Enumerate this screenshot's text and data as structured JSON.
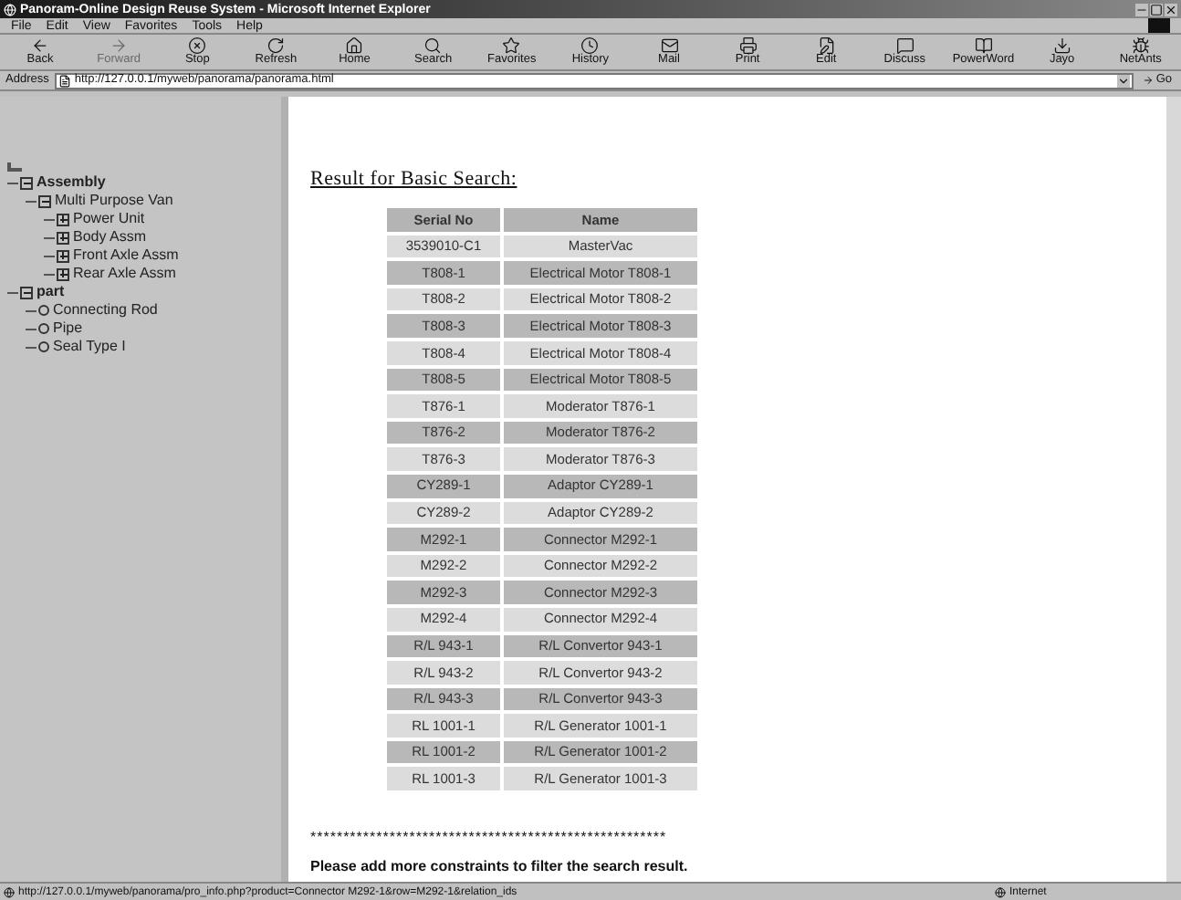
{
  "window": {
    "title": "Panoram-Online Design Reuse System - Microsoft Internet Explorer"
  },
  "menu": [
    "File",
    "Edit",
    "View",
    "Favorites",
    "Tools",
    "Help"
  ],
  "toolbar": [
    {
      "label": "Back",
      "kind": "back",
      "disabled": false
    },
    {
      "label": "Forward",
      "kind": "forward",
      "disabled": true
    },
    {
      "label": "Stop",
      "kind": "stop",
      "disabled": false
    },
    {
      "label": "Refresh",
      "kind": "refresh",
      "disabled": false
    },
    {
      "label": "Home",
      "kind": "home",
      "disabled": false
    },
    {
      "label": "Search",
      "kind": "search",
      "disabled": false
    },
    {
      "label": "Favorites",
      "kind": "favorites",
      "disabled": false
    },
    {
      "label": "History",
      "kind": "history",
      "disabled": false
    },
    {
      "label": "Mail",
      "kind": "mail",
      "disabled": false
    },
    {
      "label": "Print",
      "kind": "print",
      "disabled": false
    },
    {
      "label": "Edit",
      "kind": "edit",
      "disabled": false
    },
    {
      "label": "Discuss",
      "kind": "discuss",
      "disabled": false
    },
    {
      "label": "PowerWord",
      "kind": "powerword",
      "disabled": false
    },
    {
      "label": "Jayo",
      "kind": "jayo",
      "disabled": false
    },
    {
      "label": "NetAnts",
      "kind": "netants",
      "disabled": false
    }
  ],
  "address": {
    "label": "Address",
    "value": "http://127.0.0.1/myweb/panorama/panorama.html",
    "go": "Go"
  },
  "tree": [
    {
      "label": "Assembly",
      "kind": "folder",
      "expanded": true,
      "bold": true,
      "children": [
        {
          "label": "Multi Purpose Van",
          "kind": "folder",
          "expanded": true,
          "bold": false,
          "children": [
            {
              "label": "Power Unit",
              "kind": "folder",
              "expanded": false,
              "bold": false
            },
            {
              "label": "Body Assm",
              "kind": "folder",
              "expanded": false,
              "bold": false
            },
            {
              "label": "Front Axle Assm",
              "kind": "folder",
              "expanded": false,
              "bold": false
            },
            {
              "label": "Rear Axle Assm",
              "kind": "folder",
              "expanded": false,
              "bold": false
            }
          ]
        }
      ]
    },
    {
      "label": "part",
      "kind": "folder",
      "expanded": true,
      "bold": true,
      "children": [
        {
          "label": "Connecting Rod",
          "kind": "leaf",
          "bold": false
        },
        {
          "label": "Pipe",
          "kind": "leaf",
          "bold": false
        },
        {
          "label": "Seal Type I",
          "kind": "leaf",
          "bold": false
        }
      ]
    }
  ],
  "heading": "Result for Basic Search:",
  "table": {
    "columns": [
      "Serial No",
      "Name"
    ],
    "rows": [
      [
        "3539010-C1",
        "MasterVac"
      ],
      [
        "T808-1",
        "Electrical Motor T808-1"
      ],
      [
        "T808-2",
        "Electrical Motor T808-2"
      ],
      [
        "T808-3",
        "Electrical Motor T808-3"
      ],
      [
        "T808-4",
        "Electrical Motor T808-4"
      ],
      [
        "T808-5",
        "Electrical Motor T808-5"
      ],
      [
        "T876-1",
        "Moderator T876-1"
      ],
      [
        "T876-2",
        "Moderator T876-2"
      ],
      [
        "T876-3",
        "Moderator T876-3"
      ],
      [
        "CY289-1",
        "Adaptor CY289-1"
      ],
      [
        "CY289-2",
        "Adaptor CY289-2"
      ],
      [
        "M292-1",
        "Connector M292-1"
      ],
      [
        "M292-2",
        "Connector M292-2"
      ],
      [
        "M292-3",
        "Connector M292-3"
      ],
      [
        "M292-4",
        "Connector M292-4"
      ],
      [
        "R/L 943-1",
        "R/L Convertor 943-1"
      ],
      [
        "R/L 943-2",
        "R/L Convertor 943-2"
      ],
      [
        "R/L 943-3",
        "R/L Convertor 943-3"
      ],
      [
        "RL 1001-1",
        "R/L Generator 1001-1"
      ],
      [
        "RL 1001-2",
        "R/L Generator 1001-2"
      ],
      [
        "RL 1001-3",
        "R/L Generator 1001-3"
      ]
    ]
  },
  "separator": "******************************************************",
  "message": "Please add more constraints to filter the search result.",
  "status_bar": {
    "url": "http://127.0.0.1/myweb/panorama/pro_info.php?product=Connector M292-1&row=M292-1&relation_ids",
    "zone": "Internet"
  }
}
